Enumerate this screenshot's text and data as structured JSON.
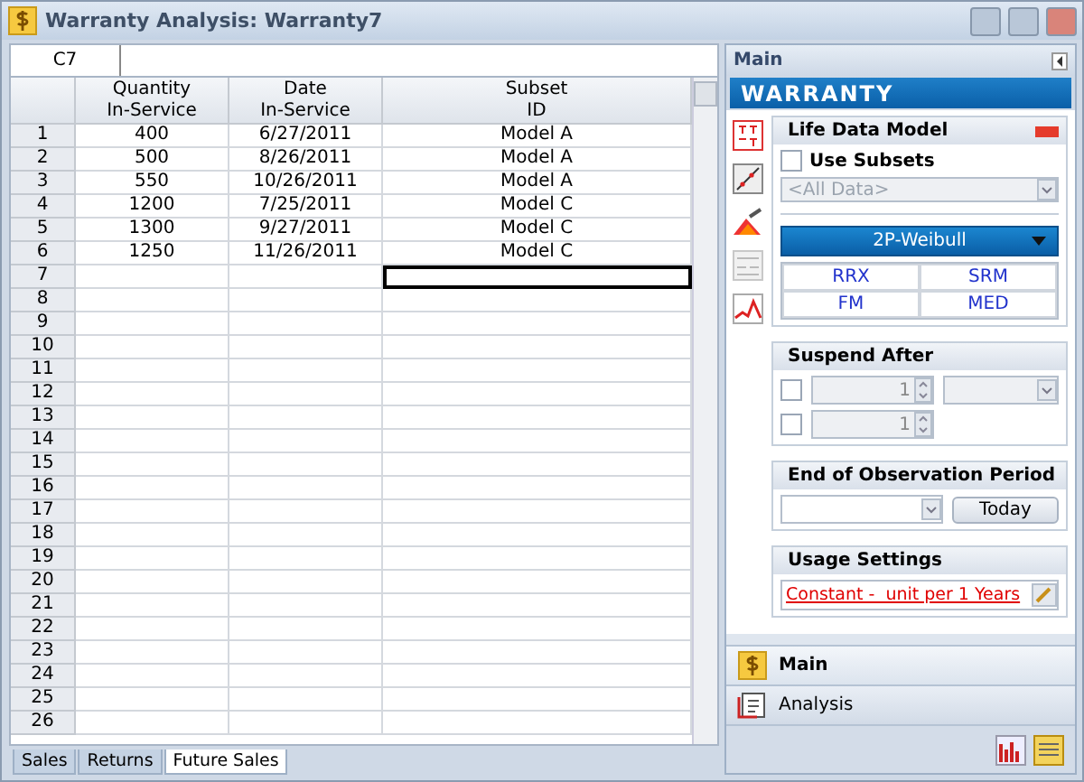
{
  "window": {
    "title": "Warranty Analysis: Warranty7"
  },
  "cell_reference": "C7",
  "columns": [
    {
      "lines": [
        "Quantity",
        "In-Service"
      ]
    },
    {
      "lines": [
        "Date",
        "In-Service"
      ]
    },
    {
      "lines": [
        "Subset",
        "ID"
      ]
    }
  ],
  "rows": [
    {
      "number": "1",
      "cells": [
        {
          "text": "400",
          "selected": false
        },
        {
          "text": "6/27/2011",
          "selected": false
        },
        {
          "text": "Model A",
          "selected": false
        }
      ]
    },
    {
      "number": "2",
      "cells": [
        {
          "text": "500",
          "selected": false
        },
        {
          "text": "8/26/2011",
          "selected": false
        },
        {
          "text": "Model A",
          "selected": false
        }
      ]
    },
    {
      "number": "3",
      "cells": [
        {
          "text": "550",
          "selected": false
        },
        {
          "text": "10/26/2011",
          "selected": false
        },
        {
          "text": "Model A",
          "selected": false
        }
      ]
    },
    {
      "number": "4",
      "cells": [
        {
          "text": "1200",
          "selected": false
        },
        {
          "text": "7/25/2011",
          "selected": false
        },
        {
          "text": "Model C",
          "selected": false
        }
      ]
    },
    {
      "number": "5",
      "cells": [
        {
          "text": "1300",
          "selected": false
        },
        {
          "text": "9/27/2011",
          "selected": false
        },
        {
          "text": "Model C",
          "selected": false
        }
      ]
    },
    {
      "number": "6",
      "cells": [
        {
          "text": "1250",
          "selected": false
        },
        {
          "text": "11/26/2011",
          "selected": false
        },
        {
          "text": "Model C",
          "selected": false
        }
      ]
    },
    {
      "number": "7",
      "cells": [
        {
          "selected": false
        },
        {
          "selected": false
        },
        {
          "selected": true
        }
      ]
    },
    {
      "number": "8"
    },
    {
      "number": "9"
    },
    {
      "number": "10"
    },
    {
      "number": "11"
    },
    {
      "number": "12"
    },
    {
      "number": "13"
    },
    {
      "number": "14"
    },
    {
      "number": "15"
    },
    {
      "number": "16"
    },
    {
      "number": "17"
    },
    {
      "number": "18"
    },
    {
      "number": "19"
    },
    {
      "number": "20"
    },
    {
      "number": "21"
    },
    {
      "number": "22"
    },
    {
      "number": "23"
    },
    {
      "number": "24"
    },
    {
      "number": "25"
    },
    {
      "number": "26"
    }
  ],
  "sheet_tabs": [
    {
      "label": "Sales",
      "selected": false
    },
    {
      "label": "Returns",
      "selected": false
    },
    {
      "label": "Future Sales",
      "selected": true
    }
  ],
  "panel": {
    "title": "Main",
    "banner": "WARRANTY",
    "tools": [
      {
        "kind": "parameters",
        "disabled": false
      },
      {
        "kind": "plot",
        "disabled": false
      },
      {
        "kind": "wizard",
        "disabled": false
      },
      {
        "kind": "qcp",
        "disabled": true
      },
      {
        "kind": "chart",
        "disabled": false
      }
    ],
    "life_data_model": {
      "title": "Life Data Model",
      "use_subsets": {
        "label": "Use Subsets",
        "checked": false
      },
      "subset": {
        "value": "<All Data>",
        "disabled": true
      },
      "distribution": "2P-Weibull",
      "methods": [
        "RRX",
        "SRM",
        "FM",
        "MED"
      ]
    },
    "suspend_after": {
      "title": "Suspend After",
      "rows": [
        {
          "checked": false,
          "value": "1",
          "kind": "with_unit"
        },
        {
          "checked": false,
          "value": "1",
          "kind": "plain"
        }
      ]
    },
    "end_of_observation": {
      "title": "End of Observation Period",
      "button": "Today"
    },
    "usage_settings": {
      "title": "Usage Settings",
      "link": "Constant -  unit per 1 Years"
    },
    "nav": [
      {
        "label": "Main",
        "kind": "main",
        "selected": true
      },
      {
        "label": "Analysis",
        "kind": "analysis",
        "selected": false
      }
    ]
  }
}
